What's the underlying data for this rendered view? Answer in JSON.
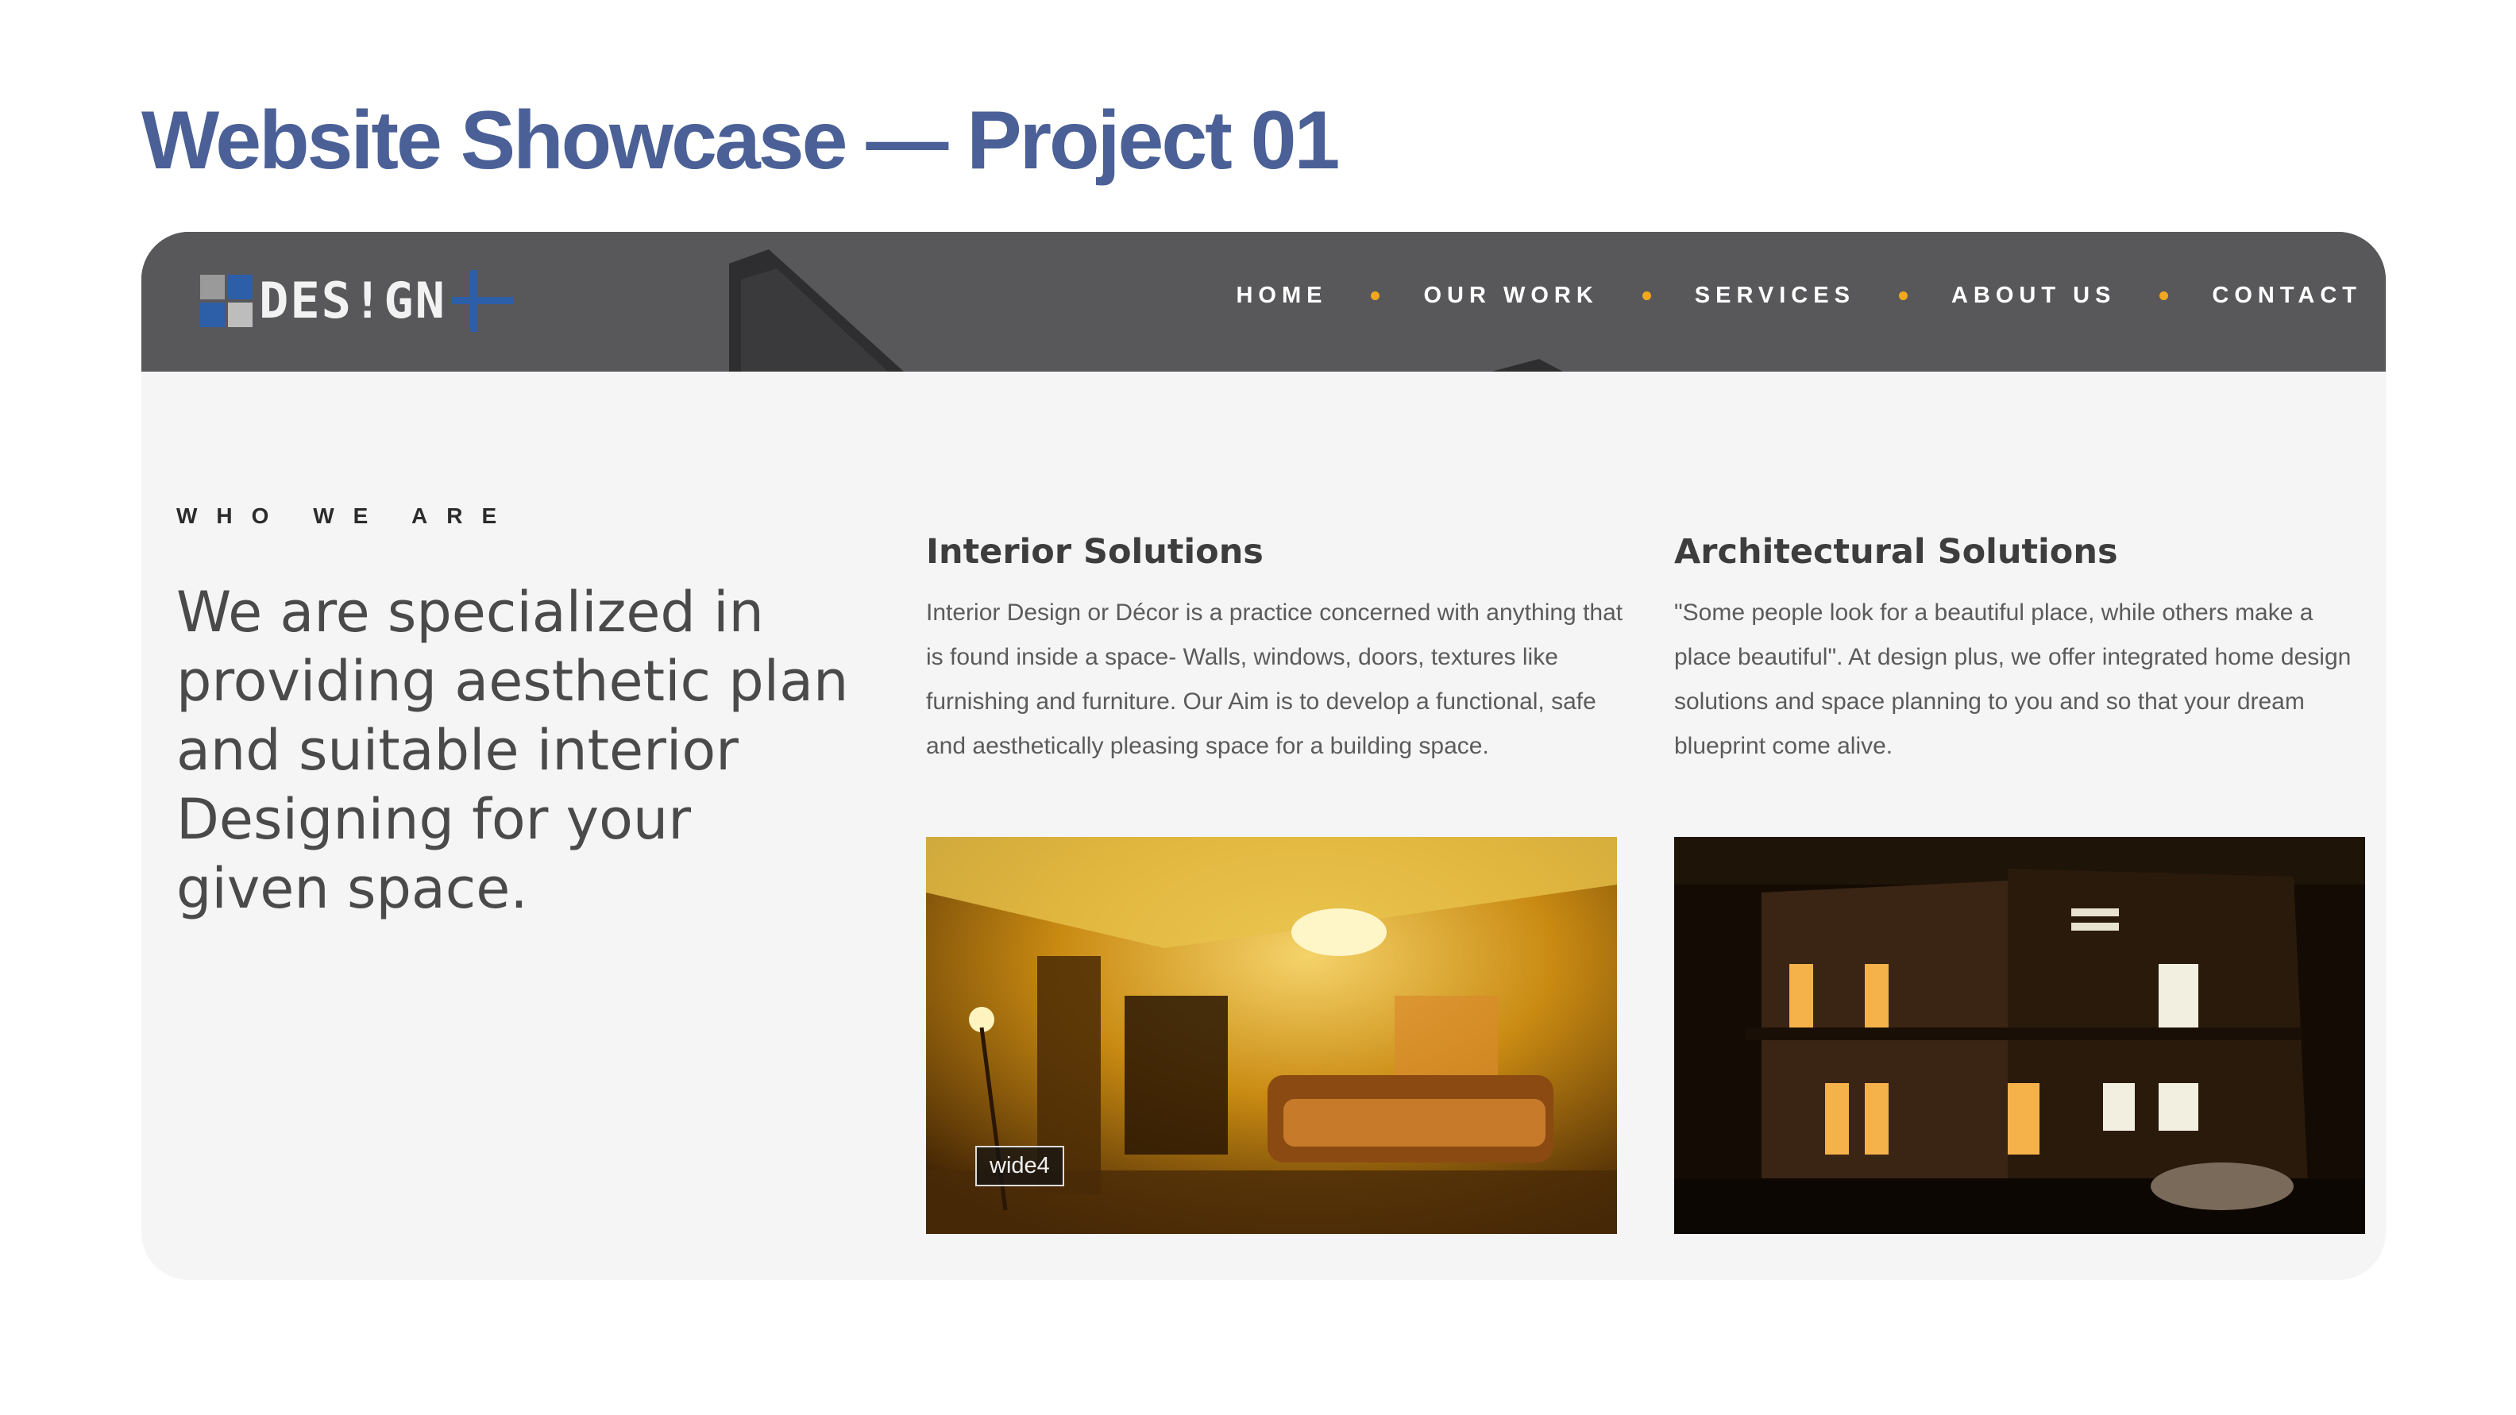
{
  "page": {
    "title": "Website Showcase — Project 01"
  },
  "site": {
    "logo": {
      "text": "DES!GN",
      "icon": "design-plus-logo",
      "plus": "+"
    },
    "nav": [
      {
        "label": "HOME"
      },
      {
        "label": "OUR WORK"
      },
      {
        "label": "SERVICES"
      },
      {
        "label": "ABOUT US"
      },
      {
        "label": "CONTACT"
      }
    ],
    "colors": {
      "title": "#4a6096",
      "header_bg": "#58585a",
      "nav_dot": "#f2a81e",
      "logo_blue": "#2d5ea8",
      "content_bg": "#f5f5f5"
    }
  },
  "about": {
    "eyebrow": "WHO WE ARE",
    "headline": "We are specialized in providing aesthetic plan and suitable interior Designing for your given space."
  },
  "services": [
    {
      "title": "Interior Solutions",
      "text": "Interior Design or Décor is a practice concerned with anything that is found inside a space- Walls, windows, doors, textures like furnishing and furniture. Our Aim is to develop a functional, safe and aesthetically pleasing space for a building space.",
      "image": {
        "subject": "warm-lit-living-room-interior-photo",
        "caption": "wide4"
      }
    },
    {
      "title": "Architectural Solutions",
      "text": "\"Some people look for a beautiful place, while others make a place beautiful\". At design plus, we offer integrated home design solutions and space planning to you and so that your dream blueprint come alive.",
      "image": {
        "subject": "modern-house-exterior-night-photo"
      }
    }
  ]
}
